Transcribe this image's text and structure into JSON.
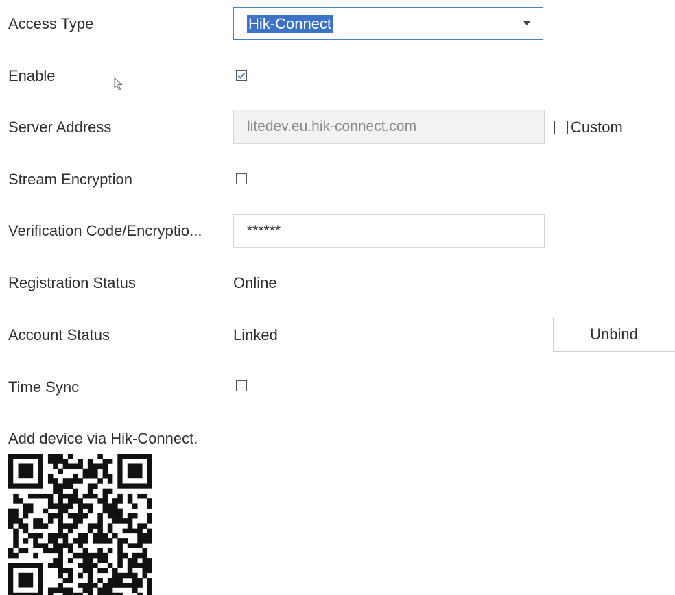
{
  "rows": {
    "access_type": {
      "label": "Access Type",
      "value": "Hik-Connect"
    },
    "enable": {
      "label": "Enable",
      "checked": true
    },
    "server_address": {
      "label": "Server Address",
      "value": "litedev.eu.hik-connect.com",
      "custom_label": "Custom",
      "custom_checked": false
    },
    "stream_encryption": {
      "label": "Stream Encryption",
      "checked": false
    },
    "verification_code": {
      "label": "Verification Code/Encryptio...",
      "value": "******"
    },
    "registration_status": {
      "label": "Registration Status",
      "value": "Online"
    },
    "account_status": {
      "label": "Account Status",
      "value": "Linked",
      "button_label": "Unbind"
    },
    "time_sync": {
      "label": "Time Sync",
      "checked": false
    }
  },
  "qr_caption": "Add device via Hik-Connect.",
  "icons": {
    "dropdown": "chevron-down-icon",
    "checkmark": "checkmark-icon",
    "cursor": "mouse-pointer-icon",
    "qr": "qr-code"
  },
  "colors": {
    "selection_bg": "#3d73c6",
    "focus_border": "#4a7fc8",
    "disabled_bg": "#f2f2f2"
  }
}
